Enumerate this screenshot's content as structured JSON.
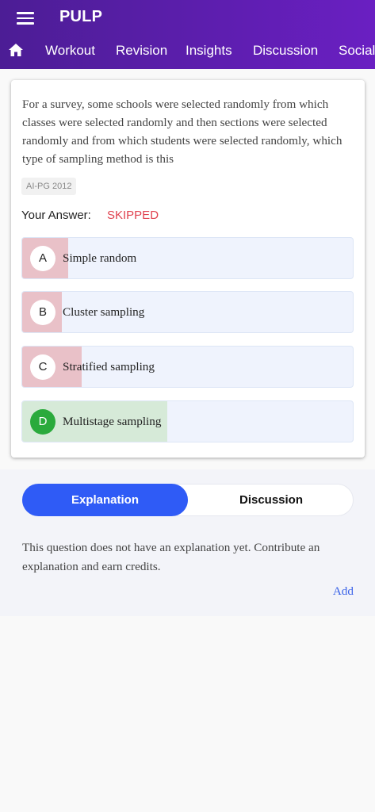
{
  "app": {
    "title": "PULP"
  },
  "nav": {
    "home_icon": "home-icon",
    "tabs": [
      "Workout",
      "Revision",
      "Insights",
      "Discussion",
      "Social"
    ]
  },
  "question": {
    "text": "For a survey, some schools were selected randomly from which classes were selected randomly and then sections were selected randomly and from which students were selected randomly, which type of sampling method is this",
    "tag": "AI-PG 2012",
    "answer_label": "Your Answer:",
    "answer_value": "SKIPPED"
  },
  "options": [
    {
      "letter": "A",
      "text": "Simple random",
      "status": "incorrect",
      "share": 0.14
    },
    {
      "letter": "B",
      "text": "Cluster sampling",
      "status": "incorrect",
      "share": 0.12
    },
    {
      "letter": "C",
      "text": "Stratified sampling",
      "status": "incorrect",
      "share": 0.18
    },
    {
      "letter": "D",
      "text": "Multistage sampling",
      "status": "correct",
      "share": 0.44
    }
  ],
  "colors": {
    "incorrect_fill": "#e9c1c8",
    "correct_fill": "#d6ead8"
  },
  "explanation": {
    "tabs": [
      "Explanation",
      "Discussion"
    ],
    "active_tab": "Explanation",
    "text": "This question does not have an explanation yet. Contribute an explanation and earn credits.",
    "add_label": "Add"
  }
}
